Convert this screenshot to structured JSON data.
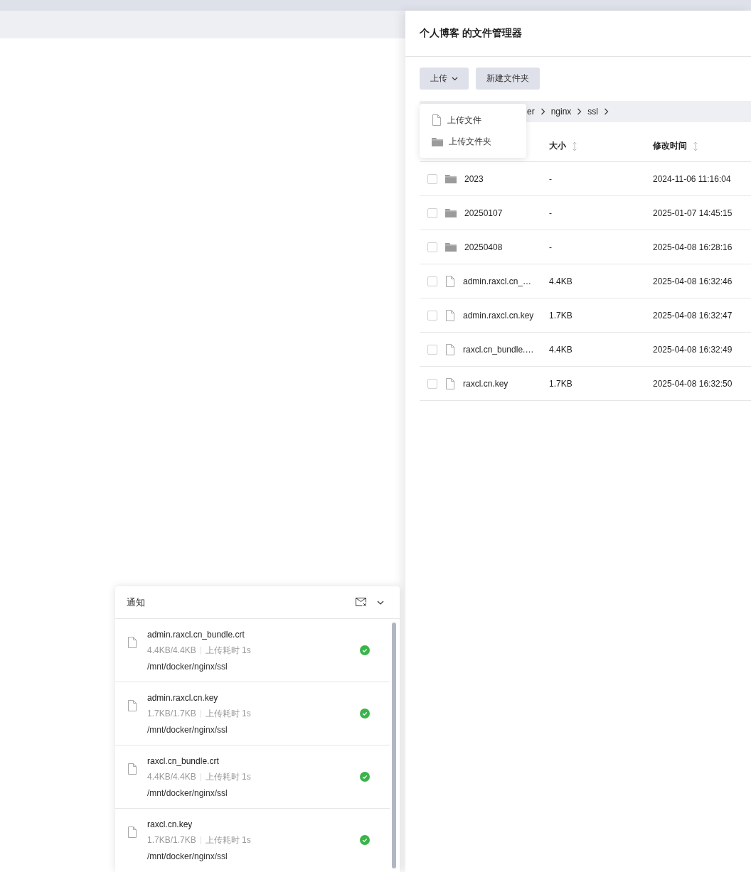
{
  "panel": {
    "title": "个人博客 的文件管理器"
  },
  "toolbar": {
    "buttons": [
      {
        "label": "上传",
        "kind": "dropdown"
      },
      {
        "label": "新建文件夹",
        "kind": "plain"
      }
    ]
  },
  "upload_menu": {
    "items": [
      {
        "label": "上传文件",
        "kind": "file"
      },
      {
        "label": "上传文件夹",
        "kind": "folder"
      }
    ]
  },
  "breadcrumb": [
    "er",
    "nginx",
    "ssl"
  ],
  "table": {
    "columns": [
      "大小",
      "修改时间"
    ],
    "rows": [
      {
        "kind": "folder",
        "name": "2023",
        "size": "-",
        "modified": "2024-11-06 11:16:04",
        "checked": false
      },
      {
        "kind": "folder",
        "name": "20250107",
        "size": "-",
        "modified": "2025-01-07 14:45:15",
        "checked": false
      },
      {
        "kind": "folder",
        "name": "20250408",
        "size": "-",
        "modified": "2025-04-08 16:28:16",
        "checked": false
      },
      {
        "kind": "file",
        "name": "admin.raxcl.cn_…",
        "size": "4.4KB",
        "modified": "2025-04-08 16:32:46",
        "checked": false
      },
      {
        "kind": "file",
        "name": "admin.raxcl.cn.key",
        "size": "1.7KB",
        "modified": "2025-04-08 16:32:47",
        "checked": false
      },
      {
        "kind": "file",
        "name": "raxcl.cn_bundle.…",
        "size": "4.4KB",
        "modified": "2025-04-08 16:32:49",
        "checked": false
      },
      {
        "kind": "file",
        "name": "raxcl.cn.key",
        "size": "1.7KB",
        "modified": "2025-04-08 16:32:50",
        "checked": false
      }
    ]
  },
  "notifications": {
    "title": "通知",
    "items": [
      {
        "name": "admin.raxcl.cn_bundle.crt",
        "transferred": "4.4KB/4.4KB",
        "duration": "上传耗时 1s",
        "path": "/mnt/docker/nginx/ssl",
        "done": true
      },
      {
        "name": "admin.raxcl.cn.key",
        "transferred": "1.7KB/1.7KB",
        "duration": "上传耗时 1s",
        "path": "/mnt/docker/nginx/ssl",
        "done": true
      },
      {
        "name": "raxcl.cn_bundle.crt",
        "transferred": "4.4KB/4.4KB",
        "duration": "上传耗时 1s",
        "path": "/mnt/docker/nginx/ssl",
        "done": true
      },
      {
        "name": "raxcl.cn.key",
        "transferred": "1.7KB/1.7KB",
        "duration": "上传耗时 1s",
        "path": "/mnt/docker/nginx/ssl",
        "done": true
      }
    ]
  }
}
